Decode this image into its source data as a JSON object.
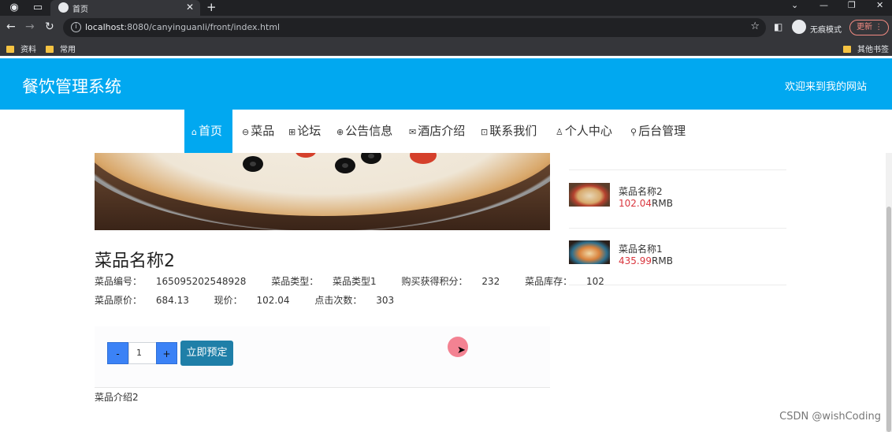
{
  "browser": {
    "tab_title": "首页",
    "url_host": "localhost",
    "url_rest": ":8080/canyinguanli/front/index.html",
    "incognito_label": "无痕模式",
    "update_label": "更新",
    "bookmarks": [
      "资料",
      "常用"
    ],
    "other_bookmarks": "其他书签"
  },
  "site": {
    "title": "餐饮管理系统",
    "welcome": "欢迎来到我的网站"
  },
  "nav": [
    {
      "label": "首页",
      "icon": "home-icon",
      "active": true
    },
    {
      "label": "菜品",
      "icon": "dish-icon"
    },
    {
      "label": "论坛",
      "icon": "forum-icon"
    },
    {
      "label": "公告信息",
      "icon": "notice-icon"
    },
    {
      "label": "酒店介绍",
      "icon": "mail-icon"
    },
    {
      "label": "联系我们",
      "icon": "book-icon"
    },
    {
      "label": "个人中心",
      "icon": "user-icon"
    },
    {
      "label": "后台管理",
      "icon": "link-icon"
    }
  ],
  "dish": {
    "name": "菜品名称2",
    "code_label": "菜品编号：",
    "code": "165095202548928",
    "type_label": "菜品类型：",
    "type": "菜品类型1",
    "points_label": "购买获得积分：",
    "points": "232",
    "stock_label": "菜品库存：",
    "stock": "102",
    "orig_price_label": "菜品原价：",
    "orig_price": "684.13",
    "price_label": "现价：",
    "price": "102.04",
    "clicks_label": "点击次数：",
    "clicks": "303",
    "intro": "菜品介绍2"
  },
  "order": {
    "minus": "-",
    "quantity": "1",
    "plus": "+",
    "reserve": "立即预定"
  },
  "sidebar": {
    "items": [
      {
        "name": "菜品名称2",
        "price": "102.04",
        "unit": "RMB"
      },
      {
        "name": "菜品名称1",
        "price": "435.99",
        "unit": "RMB"
      }
    ]
  },
  "watermark": "CSDN @wishCoding"
}
